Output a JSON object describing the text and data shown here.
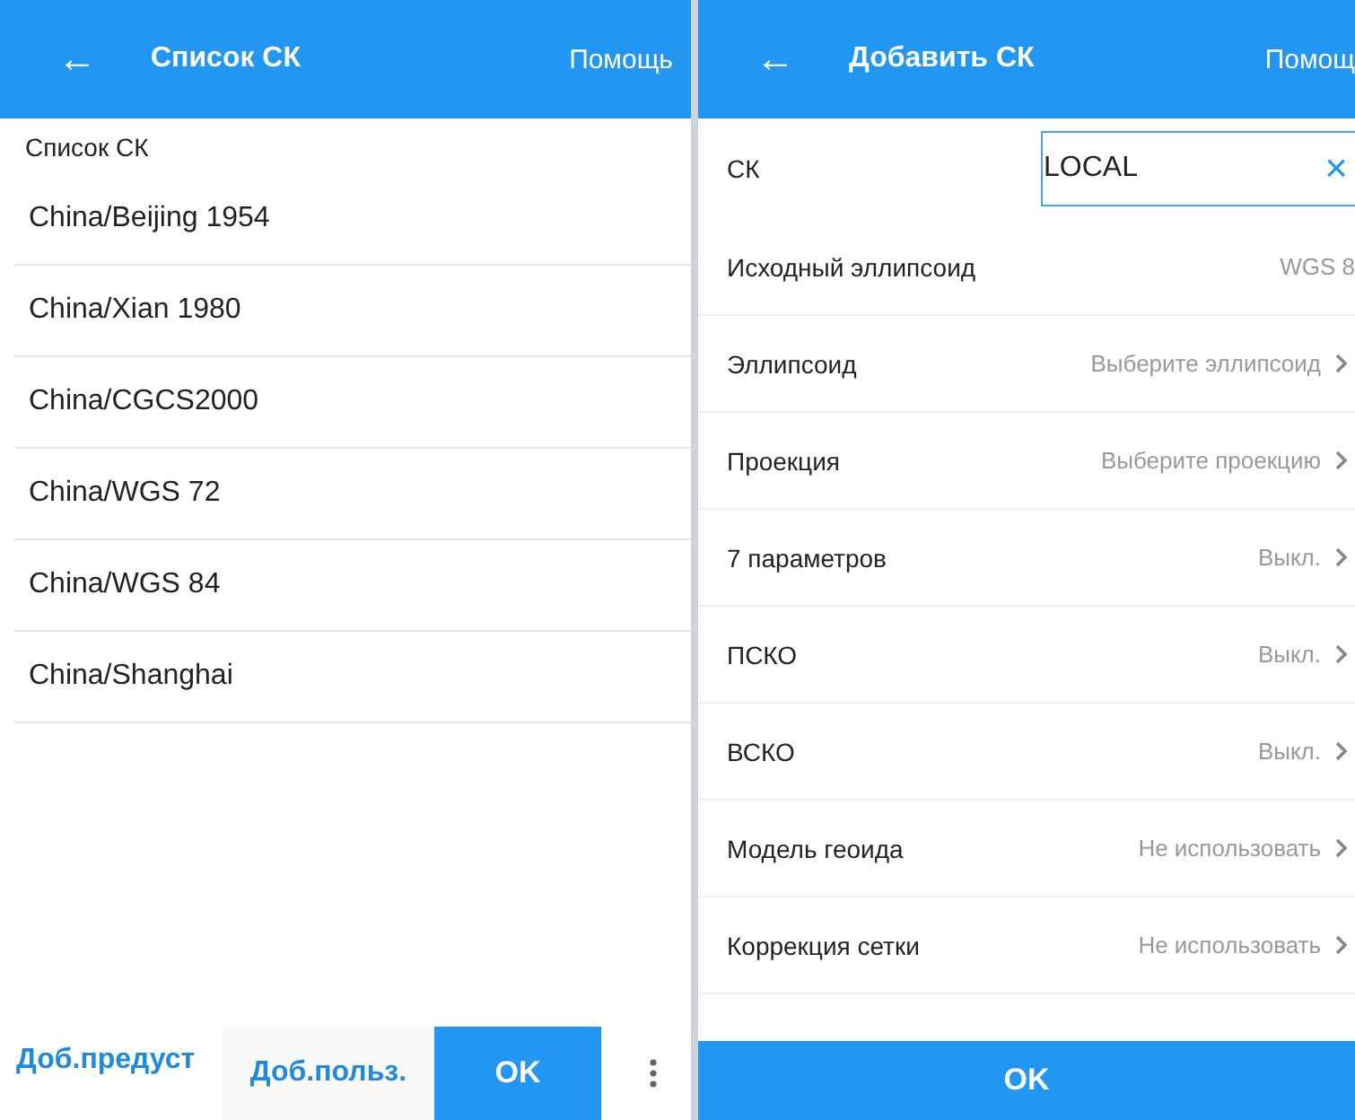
{
  "left_screen": {
    "header": {
      "back": "←",
      "title": "Список СК",
      "help": "Помощь"
    },
    "section_label": "Список СК",
    "items": [
      "China/Beijing 1954",
      "China/Xian 1980",
      "China/CGCS2000",
      "China/WGS 72",
      "China/WGS 84",
      "China/Shanghai"
    ],
    "bottom_bar": {
      "preset_link": "Доб.предуст",
      "user_button": "Доб.польз.",
      "ok_button": "OK"
    }
  },
  "right_screen": {
    "header": {
      "back": "←",
      "title": "Добавить СК",
      "help": "Помощ"
    },
    "name_field": {
      "label": "СК",
      "value": "LOCAL",
      "clear": "×"
    },
    "rows": [
      {
        "kind": "static",
        "label": "Исходный эллипсоид",
        "value": "WGS 8"
      },
      {
        "kind": "select",
        "label": "Эллипсоид",
        "value": "Выберите эллипсоид"
      },
      {
        "kind": "select",
        "label": "Проекция",
        "value": "Выберите проекцию"
      },
      {
        "kind": "select",
        "label": "7 параметров",
        "value": "Выкл."
      },
      {
        "kind": "select",
        "label": "ПСКО",
        "value": "Выкл."
      },
      {
        "kind": "select",
        "label": "ВСКО",
        "value": "Выкл."
      },
      {
        "kind": "select",
        "label": "Модель геоида",
        "value": "Не использовать"
      },
      {
        "kind": "select",
        "label": "Коррекция сетки",
        "value": "Не использовать"
      }
    ],
    "ok_button": "OK"
  }
}
